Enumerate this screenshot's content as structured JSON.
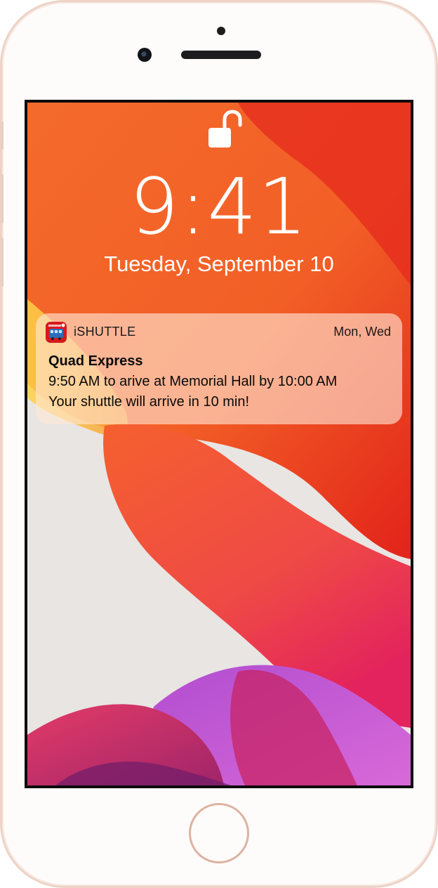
{
  "lockscreen": {
    "time": "9:41",
    "date": "Tuesday, September 10",
    "lock_icon": "unlocked-padlock-icon"
  },
  "notification": {
    "app_icon": "bus-icon",
    "app_name": "iSHUTTLE",
    "days": "Mon, Wed",
    "title": "Quad Express",
    "line1": "9:50 AM to arive at Memorial Hall by 10:00 AM",
    "line2": "Your shuttle will arrive in 10 min!"
  },
  "colors": {
    "wallpaper_orange": "#f2672a",
    "wallpaper_red": "#e8413c",
    "wallpaper_magenta": "#c4347a",
    "app_icon_red": "#d6191d"
  }
}
